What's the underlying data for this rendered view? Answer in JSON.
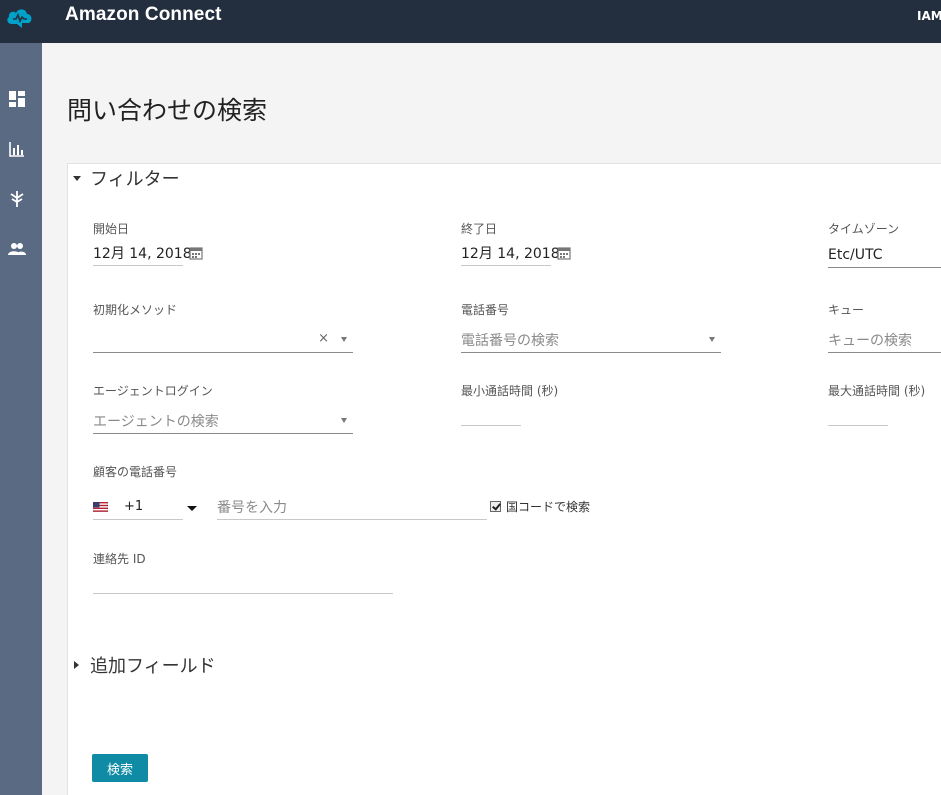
{
  "header": {
    "app_title": "Amazon Connect",
    "user": "IAM"
  },
  "sidebar": {
    "items": [
      "dashboard-icon",
      "metrics-icon",
      "routing-icon",
      "users-icon"
    ]
  },
  "page": {
    "title": "問い合わせの検索"
  },
  "filter": {
    "section_label": "フィルター",
    "start_date": {
      "label": "開始日",
      "value": "12月 14, 2018"
    },
    "end_date": {
      "label": "終了日",
      "value": "12月 14, 2018"
    },
    "timezone": {
      "label": "タイムゾーン",
      "value": "Etc/UTC"
    },
    "init_method": {
      "label": "初期化メソッド",
      "value": "",
      "clear": "×"
    },
    "phone_number": {
      "label": "電話番号",
      "placeholder": "電話番号の検索"
    },
    "queue": {
      "label": "キュー",
      "placeholder": "キューの検索"
    },
    "agent_login": {
      "label": "エージェントログイン",
      "placeholder": "エージェントの検索"
    },
    "min_duration": {
      "label": "最小通話時間 (秒)",
      "value": ""
    },
    "max_duration": {
      "label": "最大通話時間 (秒)",
      "value": ""
    },
    "customer_phone": {
      "label": "顧客の電話番号",
      "country_code": "+1",
      "placeholder": "番号を入力",
      "checkbox_label": "国コードで検索",
      "checked": true
    },
    "contact_id": {
      "label": "連絡先 ID",
      "value": ""
    }
  },
  "additional_fields": {
    "label": "追加フィールド"
  },
  "actions": {
    "search_label": "検索"
  },
  "colors": {
    "topbar": "#232f3e",
    "sidebar": "#5a6a83",
    "primary_button": "#0f8ba6",
    "logo": "#00a1c9"
  }
}
